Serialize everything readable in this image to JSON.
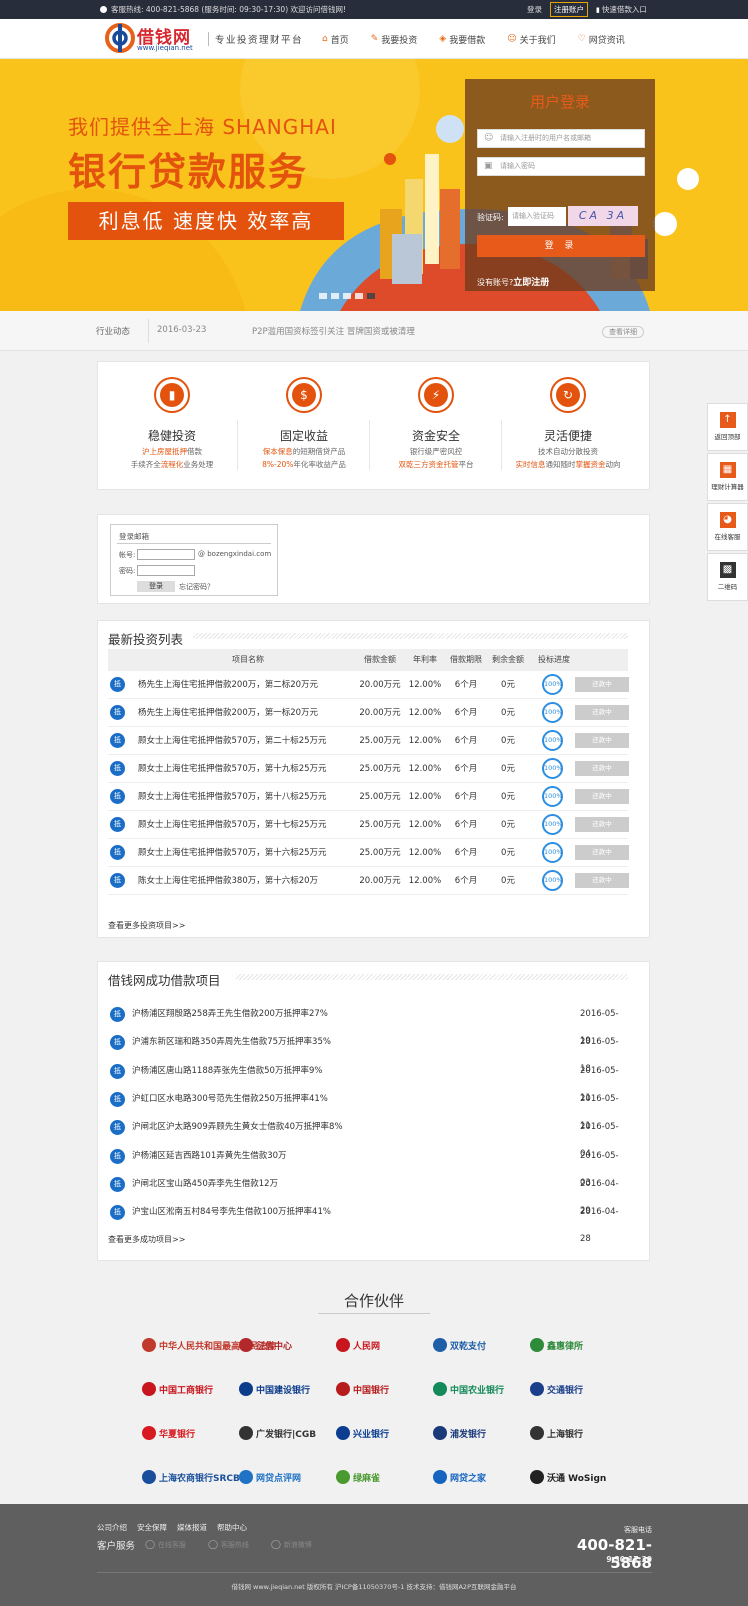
{
  "topbar": {
    "hotline": "客服热线: 400-821-5868 (服务时间: 09:30-17:30) 欢迎访问借钱网!",
    "login": "登录",
    "register": "注册账户",
    "quick_loan": "快速借款入口"
  },
  "header": {
    "brand": "借钱网",
    "url": "www.jieqian.net",
    "slogan": "专业投资理财平台",
    "nav": [
      {
        "icon": "home-icon",
        "label": "首页"
      },
      {
        "icon": "invest-icon",
        "label": "我要投资"
      },
      {
        "icon": "loan-icon",
        "label": "我要借款"
      },
      {
        "icon": "about-icon",
        "label": "关于我们"
      },
      {
        "icon": "heart-icon",
        "label": "网贷资讯"
      }
    ]
  },
  "banner": {
    "line1": "我们提供全上海 SHANGHAI",
    "line2": "银行贷款服务",
    "line3": "利息低  速度快  效率高",
    "slides": 5,
    "active_slide": 5
  },
  "login_box": {
    "title": "用户登录",
    "user_placeholder": "请输入注册时的用户名或邮箱",
    "pass_placeholder": "请输入密码",
    "captcha_label": "验证码:",
    "captcha_placeholder": "请输入验证码",
    "captcha_text": "CA 3A",
    "submit": "登 录",
    "no_account": "没有账号?",
    "register_now": "立即注册"
  },
  "news": {
    "tag": "行业动态",
    "date": "2016-03-23",
    "text": "P2P滥用国资标签引关注 冒牌国资或被清理",
    "more": "查看详细"
  },
  "features": [
    {
      "icon": "chart-icon",
      "glyph": "▮",
      "title": "稳健投资",
      "l1a": "沪上房屋抵押",
      "l1b": "借款",
      "l2a": "手续齐全",
      "l2b": "流程化",
      "l2c": "业务处理"
    },
    {
      "icon": "money-bag-icon",
      "glyph": "$",
      "title": "固定收益",
      "l1a": "保本保息",
      "l1b": "的短期借贷产品",
      "l2a": "8%-20%",
      "l2b": "年化率收益产品",
      "l2c": ""
    },
    {
      "icon": "shield-icon",
      "glyph": "⚡",
      "title": "资金安全",
      "l1a": "",
      "l1b": "银行级严密风控",
      "l2a": "双乾三方资金托管",
      "l2b": "平台",
      "l2c": ""
    },
    {
      "icon": "refresh-icon",
      "glyph": "↻",
      "title": "灵活便捷",
      "l1a": "",
      "l1b": "技术自动分散投资",
      "l2a": "实时信息",
      "l2b": "通知随时",
      "l2c": "掌握资金",
      "l2d": "动向"
    }
  ],
  "email_login": {
    "title": "登录邮箱",
    "account_label": "帐号:",
    "domain": "@ bozengxindai.com",
    "password_label": "密码:",
    "submit": "登录",
    "forgot": "忘记密码？"
  },
  "invest": {
    "title": "最新投资列表",
    "headers": [
      "项目名称",
      "借款金额",
      "年利率",
      "借款期限",
      "剩余金额",
      "投标进度"
    ],
    "badge": "抵",
    "rows": [
      {
        "name": "杨先生上海住宅抵押借款200万，第二标20万元",
        "amount": "20.00万元",
        "rate": "12.00%",
        "term": "6个月",
        "left": "0元",
        "progress": "100%",
        "status": "还款中"
      },
      {
        "name": "杨先生上海住宅抵押借款200万，第一标20万元",
        "amount": "20.00万元",
        "rate": "12.00%",
        "term": "6个月",
        "left": "0元",
        "progress": "100%",
        "status": "还款中"
      },
      {
        "name": "顾女士上海住宅抵押借款570万，第二十标25万元",
        "amount": "25.00万元",
        "rate": "12.00%",
        "term": "6个月",
        "left": "0元",
        "progress": "100%",
        "status": "还款中"
      },
      {
        "name": "顾女士上海住宅抵押借款570万，第十九标25万元",
        "amount": "25.00万元",
        "rate": "12.00%",
        "term": "6个月",
        "left": "0元",
        "progress": "100%",
        "status": "还款中"
      },
      {
        "name": "顾女士上海住宅抵押借款570万，第十八标25万元",
        "amount": "25.00万元",
        "rate": "12.00%",
        "term": "6个月",
        "left": "0元",
        "progress": "100%",
        "status": "还款中"
      },
      {
        "name": "顾女士上海住宅抵押借款570万，第十七标25万元",
        "amount": "25.00万元",
        "rate": "12.00%",
        "term": "6个月",
        "left": "0元",
        "progress": "100%",
        "status": "还款中"
      },
      {
        "name": "顾女士上海住宅抵押借款570万，第十六标25万元",
        "amount": "25.00万元",
        "rate": "12.00%",
        "term": "6个月",
        "left": "0元",
        "progress": "100%",
        "status": "还款中"
      },
      {
        "name": "陈女士上海住宅抵押借款380万，第十六标20万",
        "amount": "20.00万元",
        "rate": "12.00%",
        "term": "6个月",
        "left": "0元",
        "progress": "100%",
        "status": "还款中"
      }
    ],
    "more": "查看更多投资项目>>"
  },
  "success": {
    "title": "借钱网成功借款项目",
    "badge": "抵",
    "rows": [
      {
        "text": "沪杨浦区翔殷路258弄王先生借款200万抵押率27%",
        "date": "2016-05-19"
      },
      {
        "text": "沪浦东新区瑞和路350弄周先生借款75万抵押率35%",
        "date": "2016-05-18"
      },
      {
        "text": "沪杨浦区唐山路1188弄张先生借款50万抵押率9%",
        "date": "2016-05-11"
      },
      {
        "text": "沪虹口区水电路300号范先生借款250万抵押率41%",
        "date": "2016-05-11"
      },
      {
        "text": "沪闸北区沪太路909弄顾先生黄女士借款40万抵押率8%",
        "date": "2016-05-04"
      },
      {
        "text": "沪杨浦区延吉西路101弄黄先生借款30万",
        "date": "2016-05-03"
      },
      {
        "text": "沪闸北区宝山路450弄李先生借款12万",
        "date": "2016-04-29"
      },
      {
        "text": "沪宝山区淞南五村84号李先生借款100万抵押率41%",
        "date": "2016-04-28"
      }
    ],
    "more": "查看更多成功项目>>"
  },
  "partners": {
    "title": "合作伙伴",
    "rows": [
      [
        {
          "name": "中华人民共和国最高人民法院",
          "color": "#c0392b"
        },
        {
          "name": "征信中心",
          "color": "#b3282d"
        },
        {
          "name": "人民网",
          "color": "#c8161e"
        },
        {
          "name": "双乾支付",
          "color": "#1f5fa8"
        },
        {
          "name": "鑫惠律所",
          "color": "#2e8b3a"
        }
      ],
      [
        {
          "name": "中国工商银行",
          "color": "#c8161e"
        },
        {
          "name": "中国建设银行",
          "color": "#0d3d8a"
        },
        {
          "name": "中国银行",
          "color": "#b71c1c"
        },
        {
          "name": "中国农业银行",
          "color": "#138a5a"
        },
        {
          "name": "交通银行",
          "color": "#1b3f8a"
        }
      ],
      [
        {
          "name": "华夏银行",
          "color": "#d71920"
        },
        {
          "name": "广发银行|CGB",
          "color": "#333333"
        },
        {
          "name": "兴业银行",
          "color": "#0b3d91"
        },
        {
          "name": "浦发银行",
          "color": "#1a3a7a"
        },
        {
          "name": "上海银行",
          "color": "#333333"
        }
      ],
      [
        {
          "name": "上海农商银行SRCB",
          "color": "#1a4f9c"
        },
        {
          "name": "网贷点评网",
          "color": "#1f72c4"
        },
        {
          "name": "绿麻雀",
          "color": "#4a9b2f"
        },
        {
          "name": "网贷之家",
          "color": "#1565c0"
        },
        {
          "name": "沃通 WoSign",
          "color": "#222222"
        }
      ]
    ]
  },
  "footer": {
    "links": [
      "公司介绍",
      "安全保障",
      "媒体报道",
      "帮助中心"
    ],
    "service": "客户服务",
    "channels": [
      "在线客服",
      "客服热线",
      "新浪微博"
    ],
    "tel_label": "客服电话",
    "tel": "400-821-5868",
    "hours": "9:30-17:30",
    "copyright": "借钱网 www.jieqian.net 版权所有 沪ICP备11050370号-1 技术支持：借钱网A2P互联网金融平台"
  },
  "sidebar": [
    {
      "icon": "arrow-up-icon",
      "label": "返回顶部"
    },
    {
      "icon": "calculator-icon",
      "label": "理财计算器"
    },
    {
      "icon": "qq-icon",
      "label": "在线客服"
    },
    {
      "icon": "qrcode-icon",
      "label": "二维码"
    }
  ]
}
